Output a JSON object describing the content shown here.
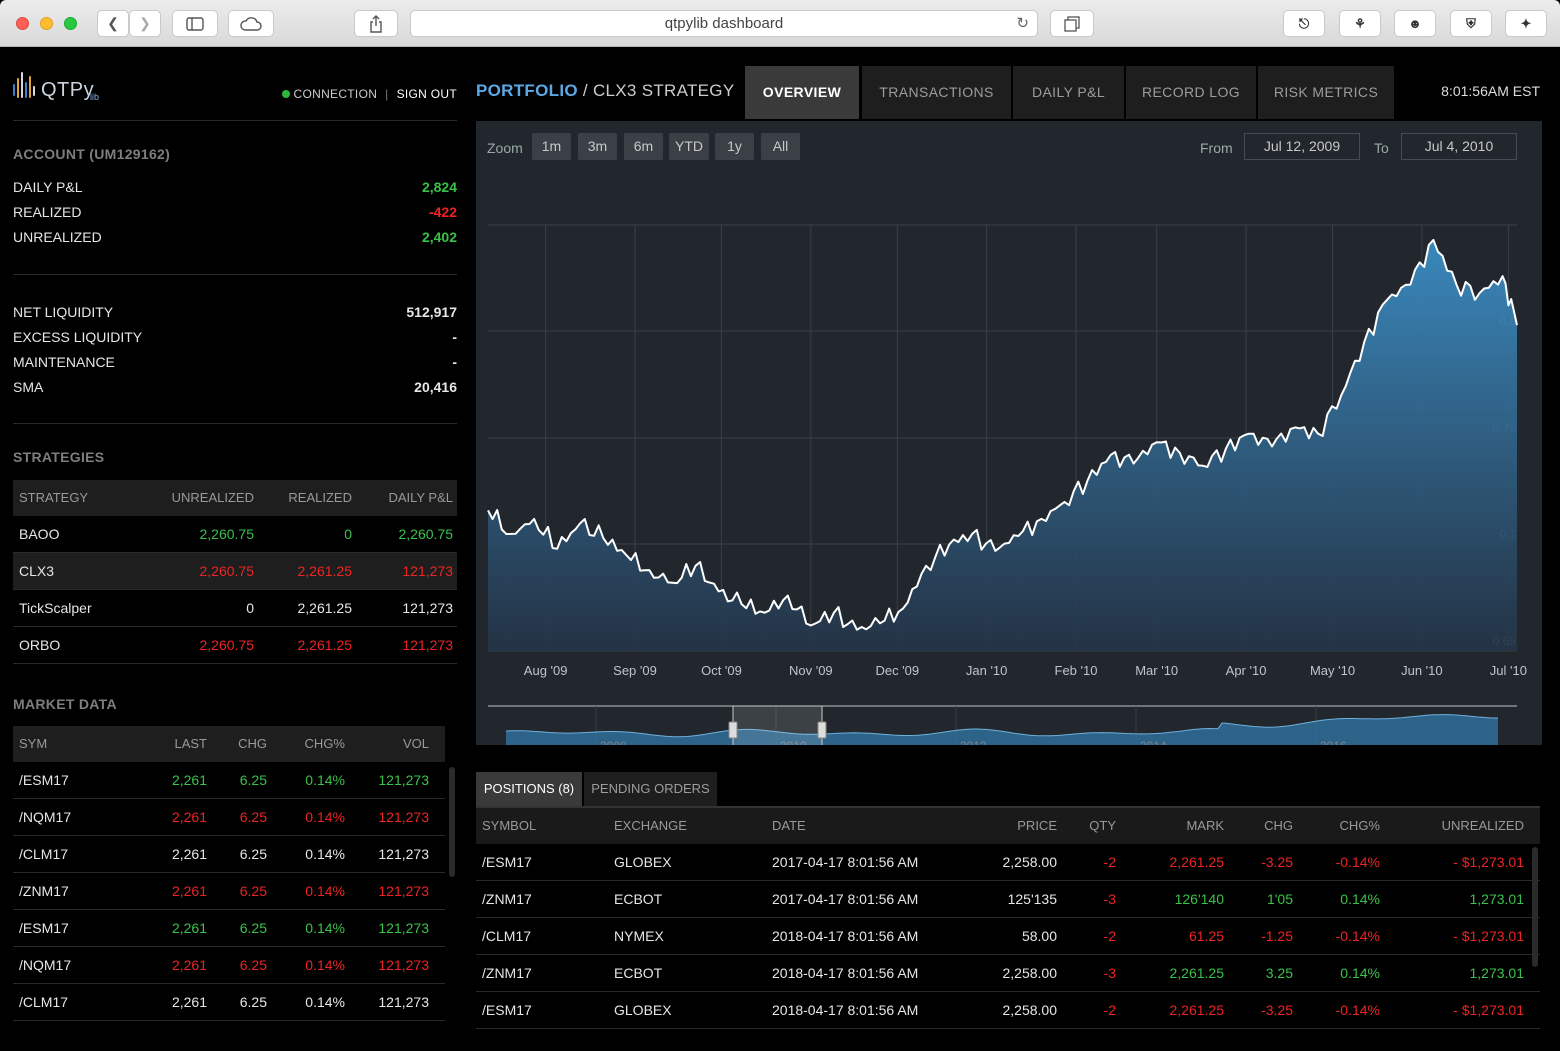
{
  "browser": {
    "url": "qtpylib  dashboard"
  },
  "app": {
    "logo_text": "QTPy",
    "logo_sub": "lib",
    "connection_label": "CONNECTION",
    "sign_out_label": "SIGN OUT"
  },
  "account": {
    "title": "ACCOUNT (UM129162)",
    "pnl_rows": [
      {
        "label": "DAILY P&L",
        "value": "2,824",
        "color": "g"
      },
      {
        "label": "REALIZED",
        "value": "-422",
        "color": "r"
      },
      {
        "label": "UNREALIZED",
        "value": "2,402",
        "color": "g"
      }
    ],
    "liquidity_rows": [
      {
        "label": "NET LIQUIDITY",
        "value": "512,917"
      },
      {
        "label": "EXCESS LIQUIDITY",
        "value": "-"
      },
      {
        "label": "MAINTENANCE",
        "value": "-"
      },
      {
        "label": "SMA",
        "value": "20,416"
      }
    ]
  },
  "strategies": {
    "title": "STRATEGIES",
    "columns": [
      "STRATEGY",
      "UNREALIZED",
      "REALIZED",
      "DAILY P&L"
    ],
    "rows": [
      {
        "cells": [
          "BAOO",
          "2,260.75",
          "0",
          "2,260.75"
        ],
        "color": "g",
        "highlight": false
      },
      {
        "cells": [
          "CLX3",
          "2,260.75",
          "2,261.25",
          "121,273"
        ],
        "color": "r",
        "highlight": true
      },
      {
        "cells": [
          "TickScalper",
          "0",
          "2,261.25",
          "121,273"
        ],
        "color": "w",
        "highlight": false
      },
      {
        "cells": [
          "ORBO",
          "2,260.75",
          "2,261.25",
          "121,273"
        ],
        "color": "r",
        "highlight": false
      }
    ]
  },
  "market_data": {
    "title": "MARKET DATA",
    "columns": [
      "SYM",
      "LAST",
      "CHG",
      "CHG%",
      "VOL"
    ],
    "rows": [
      {
        "cells": [
          "/ESM17",
          "2,261",
          "6.25",
          "0.14%",
          "121,273"
        ],
        "color": "g"
      },
      {
        "cells": [
          "/NQM17",
          "2,261",
          "6.25",
          "0.14%",
          "121,273"
        ],
        "color": "r"
      },
      {
        "cells": [
          "/CLM17",
          "2,261",
          "6.25",
          "0.14%",
          "121,273"
        ],
        "color": "w"
      },
      {
        "cells": [
          "/ZNM17",
          "2,261",
          "6.25",
          "0.14%",
          "121,273"
        ],
        "color": "r"
      },
      {
        "cells": [
          "/ESM17",
          "2,261",
          "6.25",
          "0.14%",
          "121,273"
        ],
        "color": "g"
      },
      {
        "cells": [
          "/NQM17",
          "2,261",
          "6.25",
          "0.14%",
          "121,273"
        ],
        "color": "r"
      },
      {
        "cells": [
          "/CLM17",
          "2,261",
          "6.25",
          "0.14%",
          "121,273"
        ],
        "color": "w"
      }
    ]
  },
  "header": {
    "crumb_root": "PORTFOLIO",
    "crumb_sep": " / ",
    "crumb_leaf": "CLX3 STRATEGY",
    "tabs": [
      "OVERVIEW",
      "TRANSACTIONS",
      "DAILY P&L",
      "RECORD LOG",
      "RISK METRICS"
    ],
    "active_tab": 0,
    "clock": "8:01:56AM EST"
  },
  "chart_controls": {
    "zoom_label": "Zoom",
    "zoom_buttons": [
      "1m",
      "3m",
      "6m",
      "YTD",
      "1y",
      "All"
    ],
    "from_label": "From",
    "from_value": "Jul 12, 2009",
    "to_label": "To",
    "to_value": "Jul 4, 2010"
  },
  "chart_data": {
    "type": "area",
    "x_ticks": [
      "Aug '09",
      "Sep '09",
      "Oct '09",
      "Nov '09",
      "Dec '09",
      "Jan '10",
      "Feb '10",
      "Mar '10",
      "Apr '10",
      "May '10",
      "Jun '10",
      "Jul '10"
    ],
    "y_ticks": [
      0.65,
      0.7,
      0.75,
      0.8
    ],
    "ylim": [
      0.65,
      0.85
    ],
    "x": [
      "2009-07-12",
      "2009-07-20",
      "2009-07-28",
      "2009-08-05",
      "2009-08-13",
      "2009-08-21",
      "2009-08-29",
      "2009-09-06",
      "2009-09-14",
      "2009-09-22",
      "2009-09-30",
      "2009-10-08",
      "2009-10-16",
      "2009-10-24",
      "2009-11-01",
      "2009-11-09",
      "2009-11-17",
      "2009-11-25",
      "2009-12-03",
      "2009-12-11",
      "2009-12-19",
      "2009-12-27",
      "2010-01-04",
      "2010-01-12",
      "2010-01-20",
      "2010-01-28",
      "2010-02-05",
      "2010-02-13",
      "2010-02-21",
      "2010-03-01",
      "2010-03-09",
      "2010-03-17",
      "2010-03-25",
      "2010-04-02",
      "2010-04-10",
      "2010-04-18",
      "2010-04-26",
      "2010-05-04",
      "2010-05-12",
      "2010-05-20",
      "2010-05-28",
      "2010-06-05",
      "2010-06-13",
      "2010-06-21",
      "2010-06-29",
      "2010-07-04"
    ],
    "values": [
      0.716,
      0.705,
      0.712,
      0.698,
      0.71,
      0.703,
      0.695,
      0.688,
      0.682,
      0.69,
      0.678,
      0.672,
      0.668,
      0.676,
      0.662,
      0.668,
      0.66,
      0.663,
      0.67,
      0.69,
      0.7,
      0.705,
      0.697,
      0.704,
      0.712,
      0.72,
      0.73,
      0.742,
      0.738,
      0.748,
      0.743,
      0.737,
      0.745,
      0.752,
      0.746,
      0.755,
      0.752,
      0.77,
      0.795,
      0.815,
      0.822,
      0.843,
      0.822,
      0.818,
      0.826,
      0.803
    ],
    "navigator": {
      "year_labels": [
        "2008",
        "2010",
        "2012",
        "2014",
        "2016"
      ],
      "range": [
        "2009-07-12",
        "2010-07-04"
      ]
    }
  },
  "positions": {
    "tabs": [
      "POSITIONS (8)",
      "PENDING ORDERS"
    ],
    "active_tab": 0,
    "columns": [
      "SYMBOL",
      "EXCHANGE",
      "DATE",
      "PRICE",
      "QTY",
      "MARK",
      "CHG",
      "CHG%",
      "UNREALIZED"
    ],
    "rows": [
      {
        "cells": [
          "/ESM17",
          "GLOBEX",
          "2017-04-17 8:01:56 AM",
          "2,258.00",
          "-2",
          "2,261.25",
          "-3.25",
          "-0.14%",
          "- $1,273.01"
        ],
        "color": "r"
      },
      {
        "cells": [
          "/ZNM17",
          "ECBOT",
          "2017-04-17 8:01:56 AM",
          "125'135",
          "-3",
          "126'140",
          "1'05",
          "0.14%",
          "1,273.01"
        ],
        "color": "g"
      },
      {
        "cells": [
          "/CLM17",
          "NYMEX",
          "2018-04-17 8:01:56 AM",
          "58.00",
          "-2",
          "61.25",
          "-1.25",
          "-0.14%",
          "- $1,273.01"
        ],
        "color": "r"
      },
      {
        "cells": [
          "/ZNM17",
          "ECBOT",
          "2018-04-17 8:01:56 AM",
          "2,258.00",
          "-3",
          "2,261.25",
          "3.25",
          "0.14%",
          "1,273.01"
        ],
        "color": "g"
      },
      {
        "cells": [
          "/ESM17",
          "GLOBEX",
          "2018-04-17 8:01:56 AM",
          "2,258.00",
          "-2",
          "2,261.25",
          "-3.25",
          "-0.14%",
          "- $1,273.01"
        ],
        "color": "r"
      }
    ]
  },
  "colors": {
    "accent": "#5aa9e6",
    "positive": "#39c249",
    "negative": "#ee2323",
    "chart_line": "#ffffff",
    "chart_fill": "#3b8dc4"
  }
}
